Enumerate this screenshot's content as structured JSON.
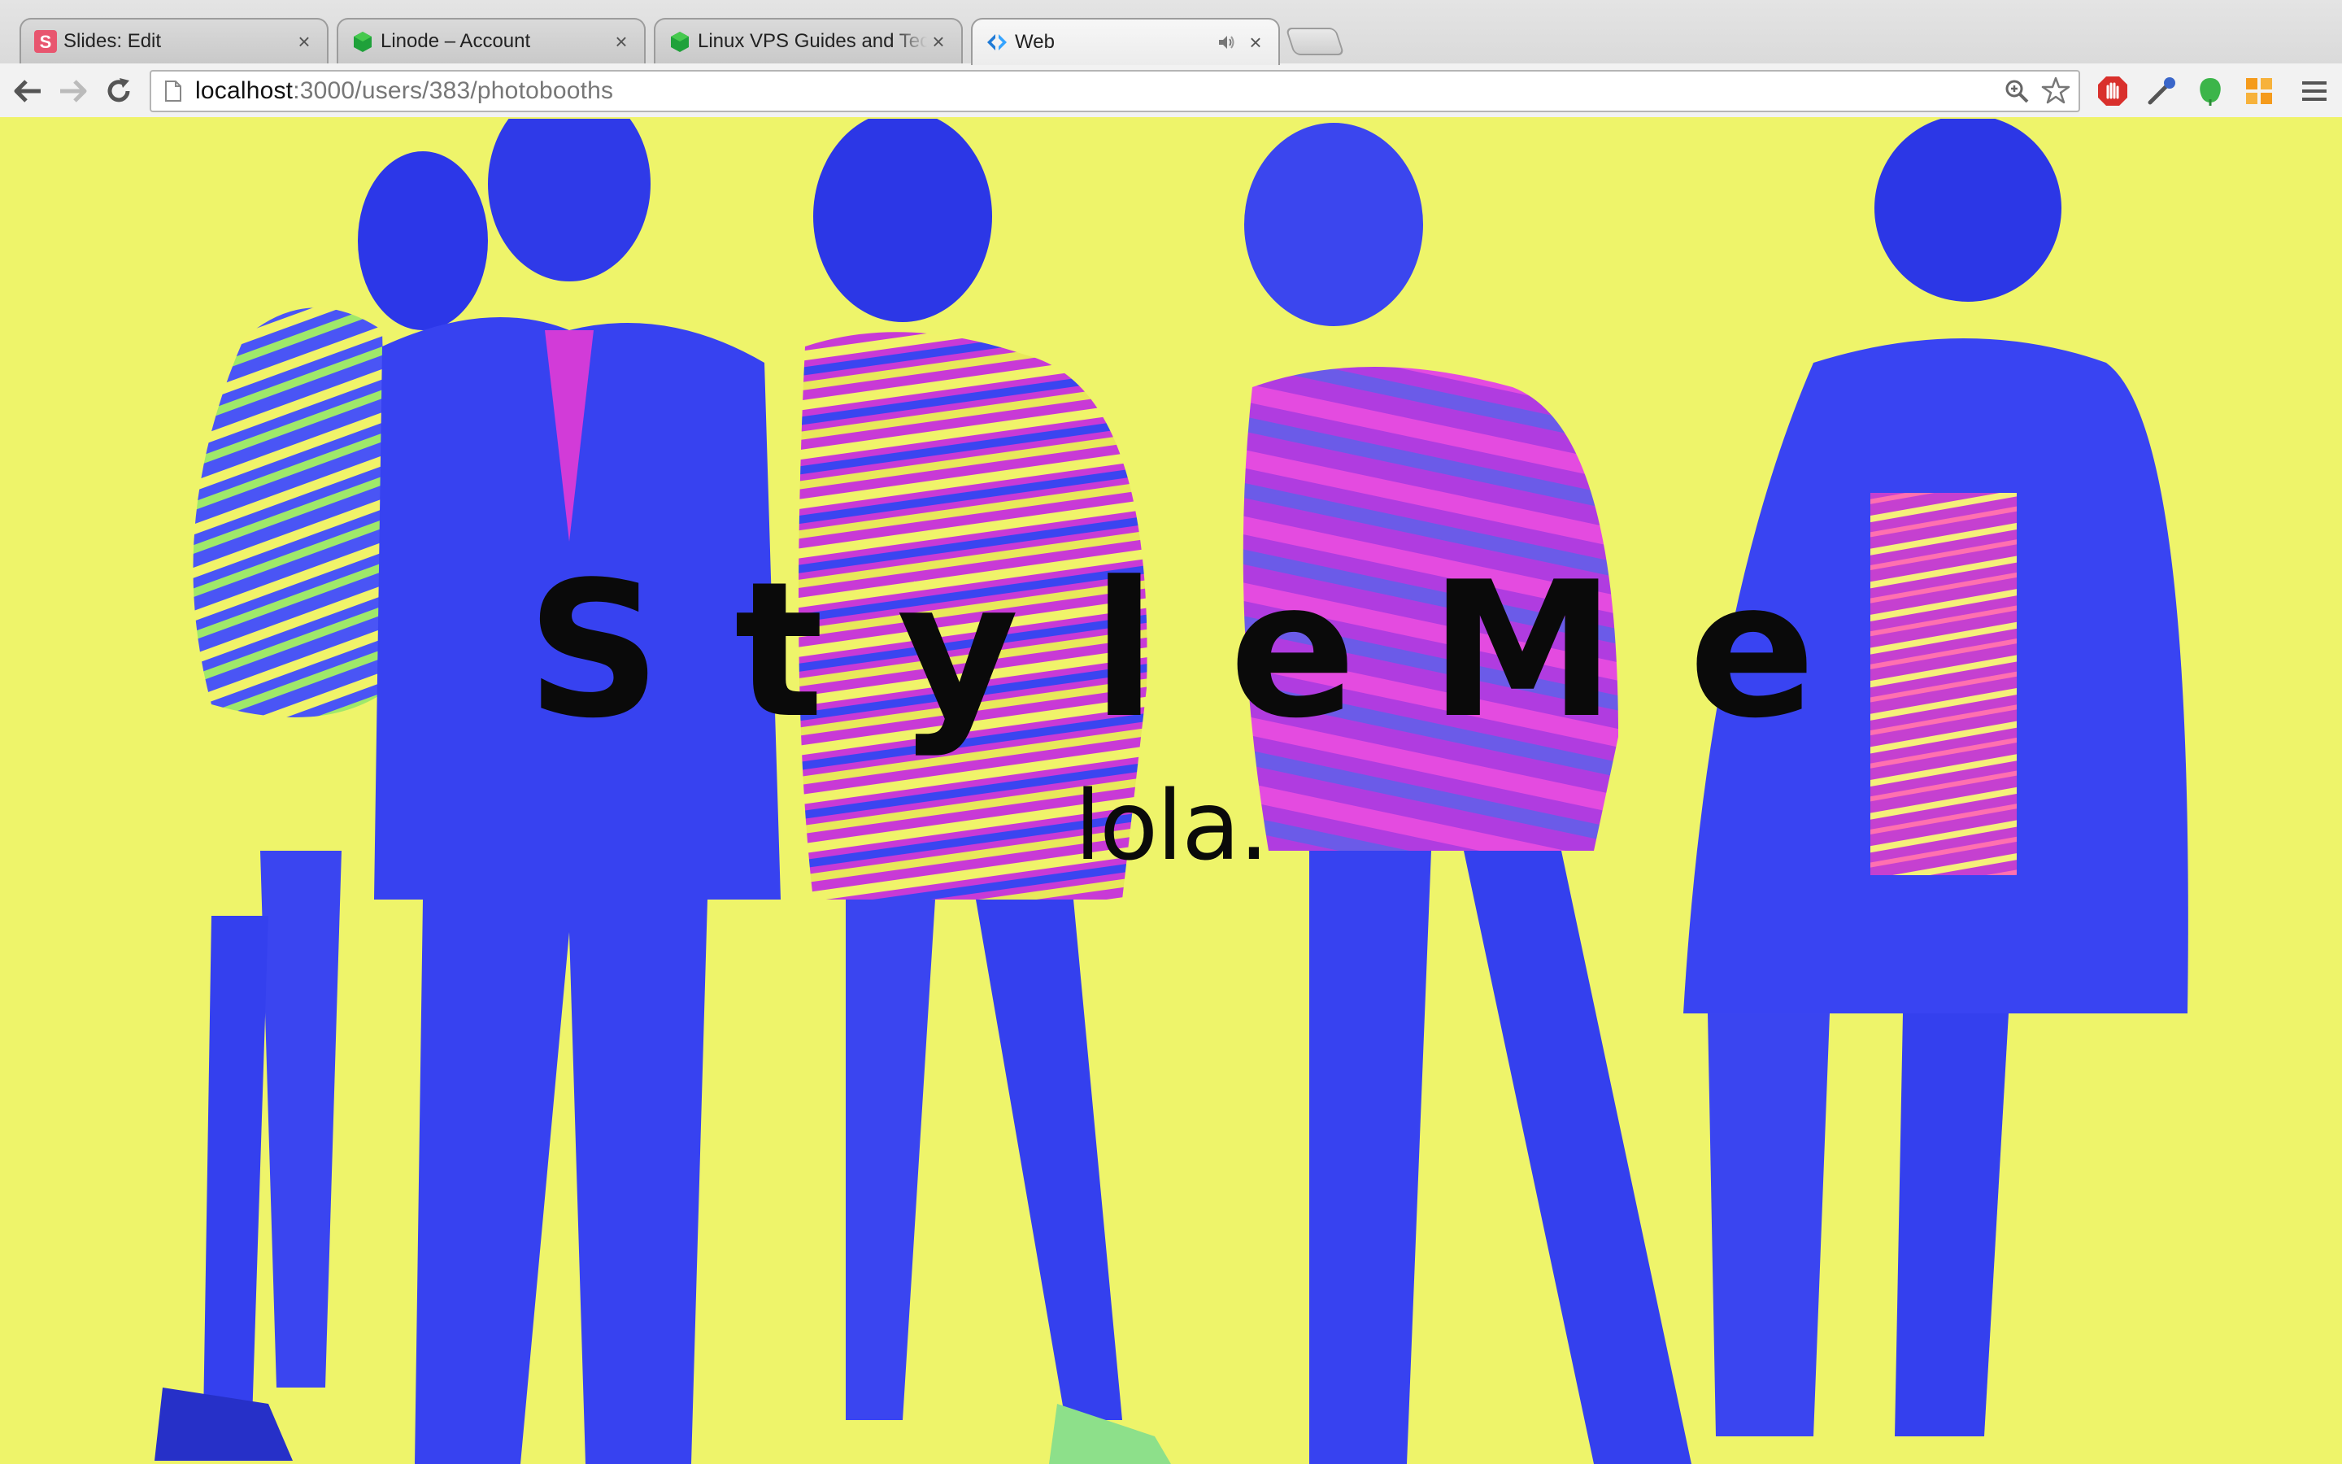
{
  "browser": {
    "tabs": [
      {
        "title": "Slides: Edit",
        "icon": "slides-icon",
        "active": false
      },
      {
        "title": "Linode – Account",
        "icon": "linode-icon",
        "active": false
      },
      {
        "title": "Linux VPS Guides and Tech",
        "icon": "linode-icon",
        "active": false
      },
      {
        "title": "Web",
        "icon": "code-icon",
        "active": true,
        "audio": true
      }
    ],
    "url_host": "localhost",
    "url_path": ":3000/users/383/photobooths",
    "extensions": [
      "adblock-icon",
      "eyedropper-icon",
      "evernote-icon",
      "grid-extension-icon",
      "menu-icon"
    ]
  },
  "page": {
    "title": "StyleMe",
    "subtitle": "lola.",
    "background_color": "#eef46a",
    "figure_color": "#3a45f0"
  }
}
